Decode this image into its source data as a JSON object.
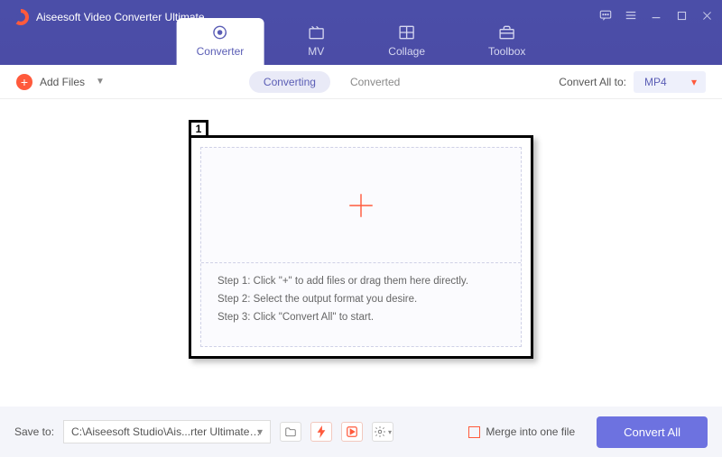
{
  "title": "Aiseesoft Video Converter Ultimate",
  "tabs": {
    "converter": "Converter",
    "mv": "MV",
    "collage": "Collage",
    "toolbox": "Toolbox"
  },
  "toolbar": {
    "add_files": "Add Files",
    "converting": "Converting",
    "converted": "Converted",
    "convert_all_to": "Convert All to:",
    "format": "MP4"
  },
  "callout": "1",
  "steps": {
    "s1": "Step 1: Click \"+\" to add files or drag them here directly.",
    "s2": "Step 2: Select the output format you desire.",
    "s3": "Step 3: Click \"Convert All\" to start."
  },
  "bottom": {
    "save_to": "Save to:",
    "path": "C:\\Aiseesoft Studio\\Ais...rter Ultimate\\Converted",
    "merge": "Merge into one file",
    "convert_all": "Convert All"
  }
}
